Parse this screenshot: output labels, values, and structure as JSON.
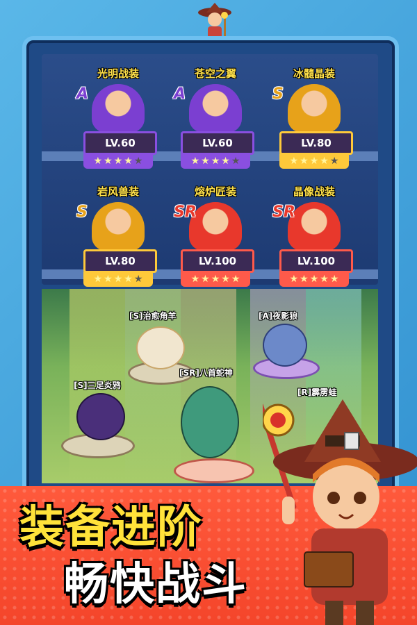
{
  "screen": {
    "type": "game promotional screenshot"
  },
  "equipment": {
    "cards": [
      {
        "name": "光明战装",
        "rank": "A",
        "level": "LV.60",
        "stars_filled": 4,
        "stars_total": 5,
        "rank_color": "#7b3fd1",
        "plate_color": "#8a4fe0"
      },
      {
        "name": "苍空之翼",
        "rank": "A",
        "level": "LV.60",
        "stars_filled": 4,
        "stars_total": 5,
        "rank_color": "#7b3fd1",
        "plate_color": "#8a4fe0"
      },
      {
        "name": "冰髓晶装",
        "rank": "S",
        "level": "LV.80",
        "stars_filled": 4,
        "stars_total": 5,
        "rank_color": "#e7a21a",
        "plate_color": "#ffc93a"
      },
      {
        "name": "岩风兽装",
        "rank": "S",
        "level": "LV.80",
        "stars_filled": 4,
        "stars_total": 5,
        "rank_color": "#e7a21a",
        "plate_color": "#ffc93a"
      },
      {
        "name": "熔炉匠装",
        "rank": "SR",
        "level": "LV.100",
        "stars_filled": 5,
        "stars_total": 5,
        "rank_color": "#e8382c",
        "plate_color": "#ff5a4a"
      },
      {
        "name": "晶像战装",
        "rank": "SR",
        "level": "LV.100",
        "stars_filled": 5,
        "stars_total": 5,
        "rank_color": "#e8382c",
        "plate_color": "#ff5a4a"
      }
    ]
  },
  "pets": [
    {
      "label": "[S]治愈角羊",
      "color": "#f1e6cf"
    },
    {
      "label": "[A]夜影狼",
      "color": "#6c89c9"
    },
    {
      "label": "[SR]八首蛇神",
      "color": "#3f9a7c"
    },
    {
      "label": "[S]三足炎鸦",
      "color": "#4a2f7a"
    },
    {
      "label": "[R]霹雳蛙",
      "color": "#6fc0e8"
    }
  ],
  "banner": {
    "line1": "装备进阶",
    "line2": "畅快战斗"
  },
  "colors": {
    "banner": "#f4452a",
    "title_yellow": "#ffe23a",
    "frame": "#1f4a86"
  }
}
